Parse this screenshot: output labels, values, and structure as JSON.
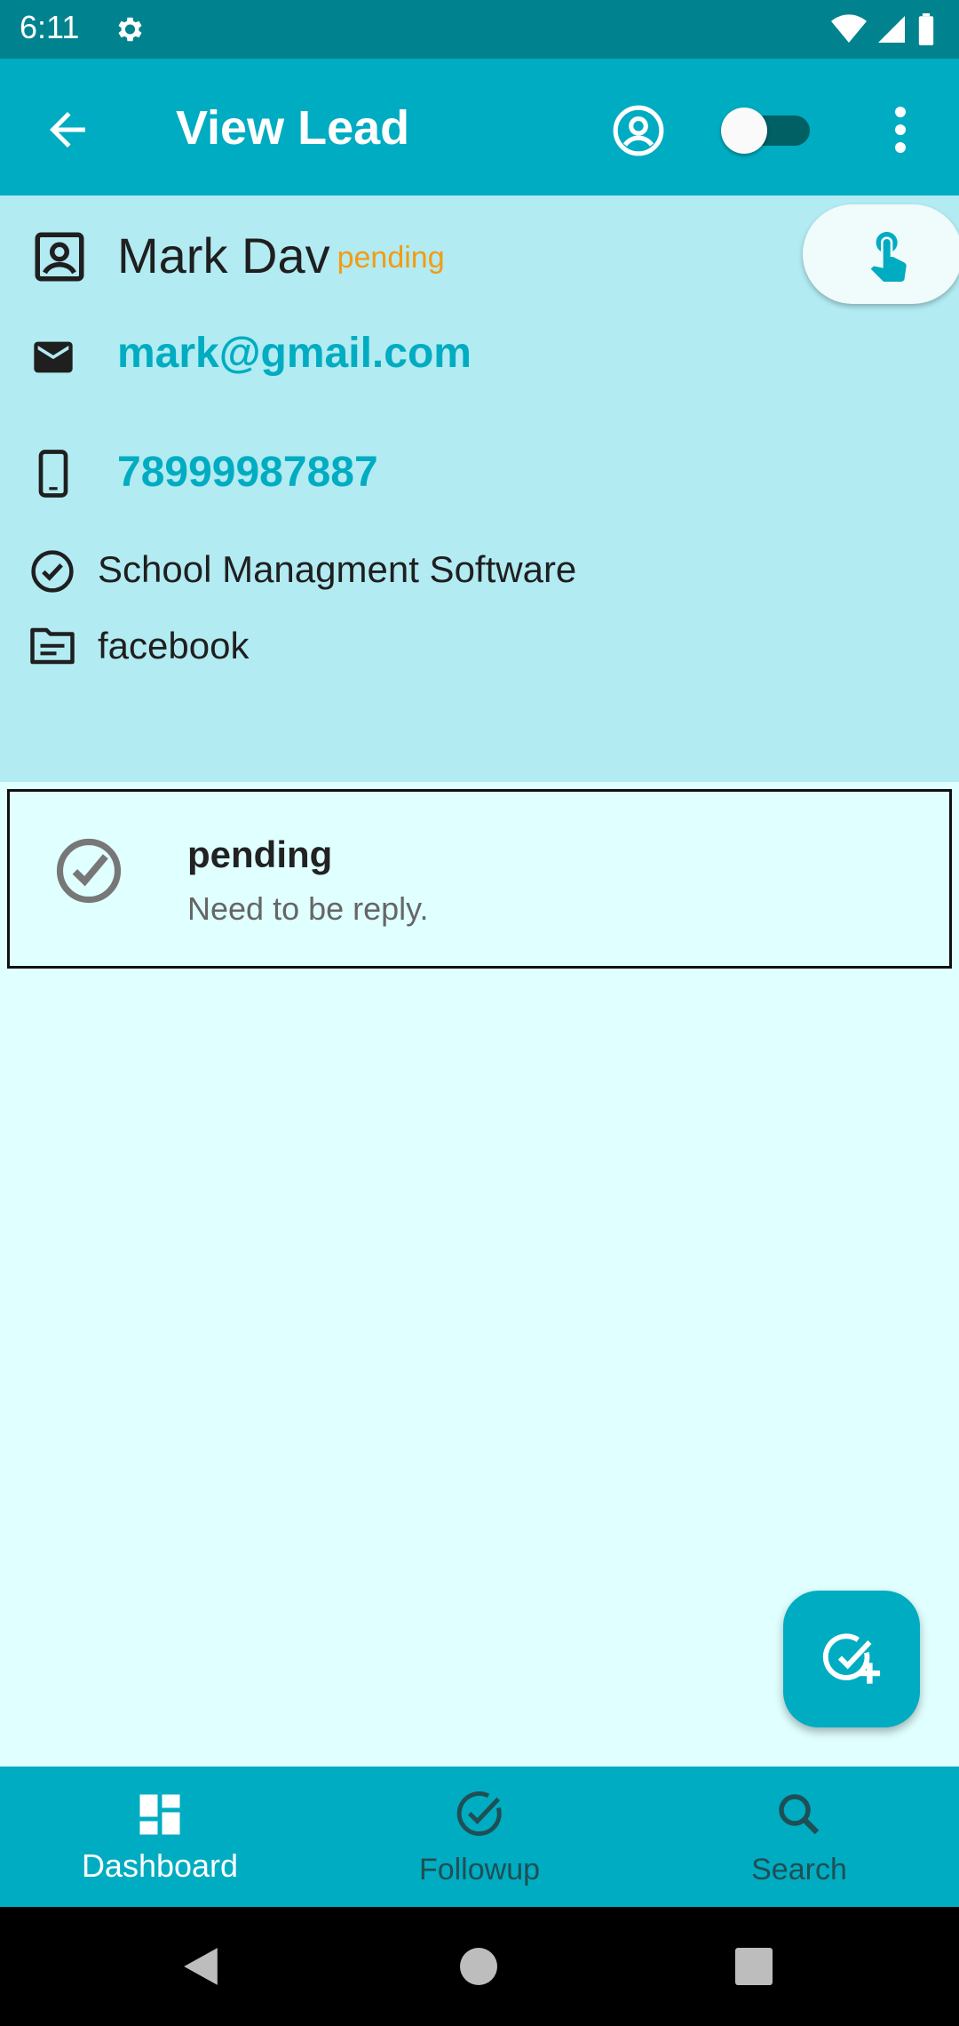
{
  "status_bar": {
    "time": "6:11"
  },
  "app_bar": {
    "title": "View Lead"
  },
  "lead": {
    "name": "Mark Dav",
    "status": "pending",
    "email": "mark@gmail.com",
    "phone": "78999987887",
    "product": "School Managment Software",
    "source": "facebook"
  },
  "followups": [
    {
      "title": "pending",
      "note": "Need to be reply."
    }
  ],
  "bottom_nav": {
    "items": [
      {
        "label": "Dashboard",
        "icon": "dashboard-icon",
        "active": true
      },
      {
        "label": "Followup",
        "icon": "check-circle-icon",
        "active": false
      },
      {
        "label": "Search",
        "icon": "search-icon",
        "active": false
      }
    ]
  },
  "colors": {
    "status_bar": "#00838f",
    "primary": "#00acc1",
    "panel": "#b2ebf2",
    "background": "#e0ffff",
    "status_accent": "#f39c12"
  }
}
